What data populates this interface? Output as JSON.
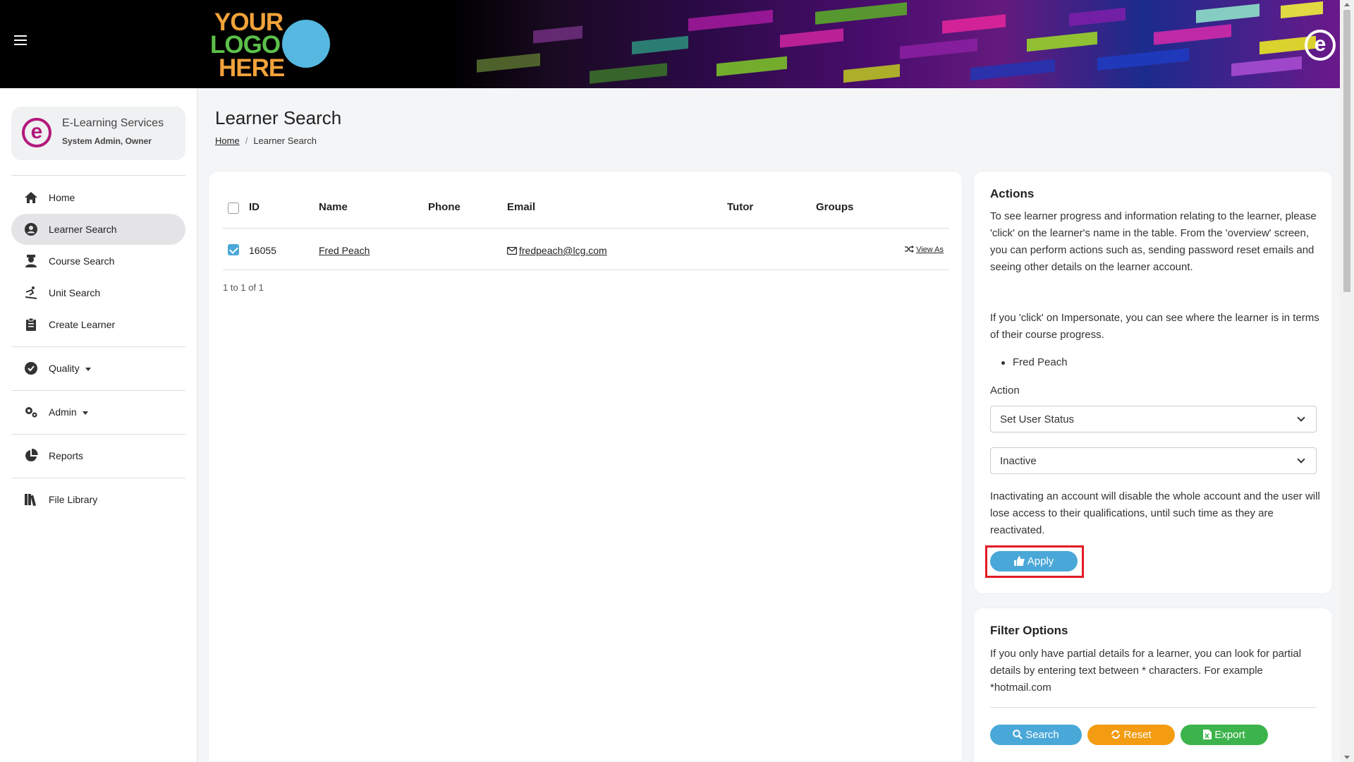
{
  "header": {
    "logo": {
      "line1": "YOUR",
      "line2": "LOGO",
      "line3": "HERE"
    },
    "colors": {
      "logo_orange": "#f2a23a",
      "logo_green": "#5cc04a",
      "logo_blue": "#56b8e0"
    }
  },
  "sidebar": {
    "profile": {
      "name": "E-Learning Services",
      "role": "System Admin, Owner"
    },
    "items": [
      {
        "label": "Home",
        "icon": "home-icon"
      },
      {
        "label": "Learner Search",
        "icon": "user-circle-icon",
        "active": true
      },
      {
        "label": "Course Search",
        "icon": "graduate-icon"
      },
      {
        "label": "Unit Search",
        "icon": "skier-icon"
      },
      {
        "label": "Create Learner",
        "icon": "clipboard-icon"
      },
      {
        "label": "Quality",
        "icon": "check-circle-icon",
        "dropdown": true
      },
      {
        "label": "Admin",
        "icon": "gears-icon",
        "dropdown": true
      },
      {
        "label": "Reports",
        "icon": "pie-chart-icon"
      },
      {
        "label": "File Library",
        "icon": "books-icon"
      }
    ]
  },
  "page": {
    "title": "Learner Search",
    "breadcrumb": {
      "home": "Home",
      "current": "Learner Search"
    }
  },
  "table": {
    "columns": [
      "ID",
      "Name",
      "Phone",
      "Email",
      "Tutor",
      "Groups"
    ],
    "rows": [
      {
        "checked": true,
        "id": "16055",
        "name": "Fred Peach",
        "phone": "",
        "email": "fredpeach@lcg.com",
        "tutor": "",
        "groups": "",
        "action": "View As"
      }
    ],
    "pager": "1 to 1 of 1"
  },
  "actions": {
    "title": "Actions",
    "intro": "To see learner progress and information relating to the learner, please 'click' on the learner's name in the table. From the 'overview' screen, you can perform actions such as, sending password reset emails and seeing other details on the learner account.",
    "impersonate": "If you 'click' on Impersonate, you can see where the learner is in terms of their course progress.",
    "selected": [
      "Fred Peach"
    ],
    "action_label": "Action",
    "action_value": "Set User Status",
    "status_value": "Inactive",
    "warning": "Inactivating an account will disable the whole account and the user will lose access to their qualifications, until such time as they are reactivated.",
    "apply_label": "Apply"
  },
  "filter": {
    "title": "Filter Options",
    "text": "If you only have partial details for a learner, you can look for partial details by entering text between * characters. For example *hotmail.com",
    "search_label": "Search",
    "reset_label": "Reset",
    "export_label": "Export"
  },
  "colors": {
    "accent_blue": "#4aa8d8",
    "orange": "#f39c12",
    "green": "#3cb44b",
    "highlight_red": "#e21b24",
    "brand_magenta": "#b2197c"
  }
}
